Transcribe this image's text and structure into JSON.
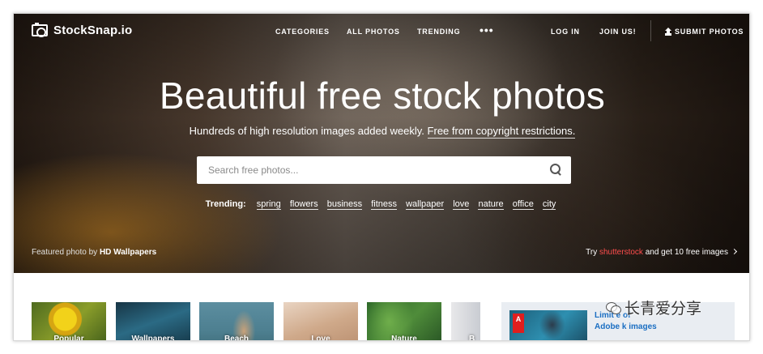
{
  "brand": {
    "name": "StockSnap.io",
    "icon": "camera-icon"
  },
  "nav": {
    "categories": "CATEGORIES",
    "all_photos": "ALL PHOTOS",
    "trending": "TRENDING",
    "more": "•••",
    "login": "LOG IN",
    "join": "JOIN US!",
    "submit": "SUBMIT PHOTOS"
  },
  "hero": {
    "title": "Beautiful free stock photos",
    "subtitle": "Hundreds of high resolution images added weekly.",
    "subtitle_link": "Free from copyright restrictions.",
    "search_placeholder": "Search free photos...",
    "trending_label": "Trending:",
    "trending_tags": [
      "spring",
      "flowers",
      "business",
      "fitness",
      "wallpaper",
      "love",
      "nature",
      "office",
      "city"
    ],
    "featured_prefix": "Featured photo by",
    "featured_author": "HD Wallpapers",
    "promo_prefix": "Try",
    "promo_brand": "shutterstock",
    "promo_suffix": "and get 10 free images"
  },
  "categories": [
    {
      "label": "Popular"
    },
    {
      "label": "Wallpapers"
    },
    {
      "label": "Beach"
    },
    {
      "label": "Love"
    },
    {
      "label": "Nature"
    },
    {
      "label": "B"
    }
  ],
  "ad": {
    "logo_text": "A",
    "line1": "Limit   e of",
    "line2": "Adobe    k images"
  },
  "watermark": {
    "text": "长青爱分享",
    "icon": "wechat-icon"
  },
  "colors": {
    "promo_brand": "#ff4d4d",
    "ad_link": "#1a6ec2"
  }
}
